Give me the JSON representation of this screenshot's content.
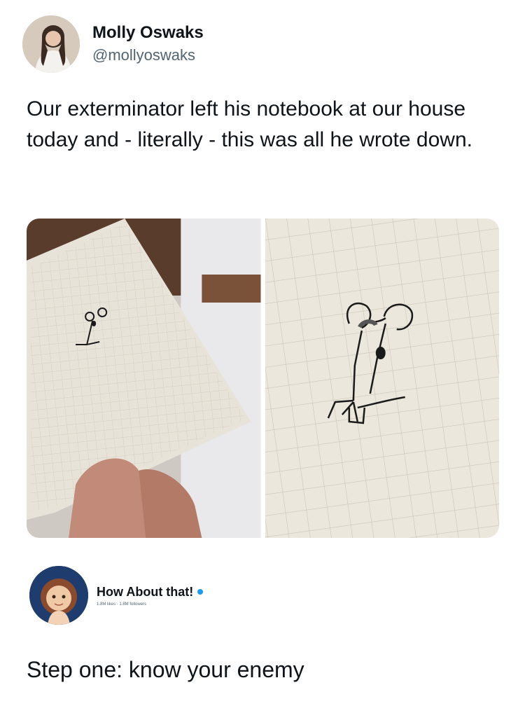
{
  "tweet": {
    "display_name": "Molly Oswaks",
    "handle": "@mollyoswaks",
    "text": "Our exterminator left his notebook at our house today and - literally - this was all he wrote down."
  },
  "media": {
    "icons": [
      "notebook-photo",
      "mouse-drawing-closeup"
    ]
  },
  "comment": {
    "brand_name": "How About that!",
    "stats": "1.8M likes · 1.8M followers",
    "text": "Step one: know your enemy"
  },
  "colors": {
    "text": "#0f1419",
    "secondary": "#536471",
    "verified": "#1d9bf0",
    "paper": "#ece8de",
    "grid": "#cfc9bb"
  }
}
